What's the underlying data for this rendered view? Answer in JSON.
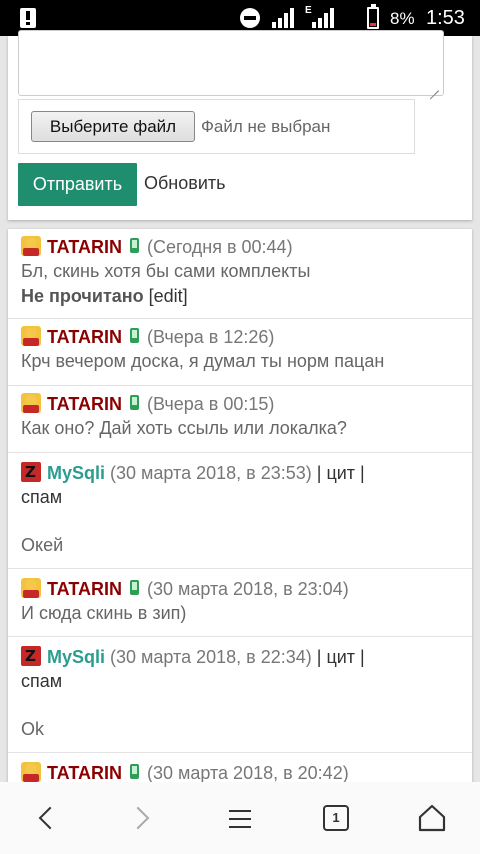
{
  "status_bar": {
    "battery_percent": "8%",
    "time": "1:53",
    "network_type": "E",
    "battery_color": "#e53935"
  },
  "form": {
    "file_button_label": "Выберите файл",
    "file_status": "Файл не выбран",
    "send_button_label": "Отправить",
    "refresh_label": "Обновить",
    "accent_color": "#1e8e6e"
  },
  "messages": [
    {
      "author": "TATARIN",
      "avatar": "tatarin-avatar-icon",
      "device": "mobile-icon",
      "date": "(Сегодня в 00:44)",
      "text": "Бл, скинь хотя бы сами комплекты",
      "unread": "Не прочитано",
      "edit": "[edit]"
    },
    {
      "author": "TATARIN",
      "avatar": "tatarin-avatar-icon",
      "device": "mobile-icon",
      "date": "(Вчера в 12:26)",
      "text": "Крч вечером доска, я думал ты норм пацан"
    },
    {
      "author": "TATARIN",
      "avatar": "tatarin-avatar-icon",
      "device": "mobile-icon",
      "date": "(Вчера в 00:15)",
      "text": "Как оно? Дай хоть ссыль или локалка?"
    },
    {
      "author": "MySqli",
      "avatar": "mysqli-avatar-icon",
      "date": "(30 марта 2018, в 23:53)",
      "actions": "| цит |",
      "actions2": "спам",
      "text": "Окей"
    },
    {
      "author": "TATARIN",
      "avatar": "tatarin-avatar-icon",
      "device": "mobile-icon",
      "date": "(30 марта 2018, в 23:04)",
      "text": "И сюда скинь в зип)"
    },
    {
      "author": "MySqli",
      "avatar": "mysqli-avatar-icon",
      "date": "(30 марта 2018, в 22:34)",
      "actions": "| цит |",
      "actions2": "спам",
      "text": "Ok"
    },
    {
      "author": "TATARIN",
      "avatar": "tatarin-avatar-icon",
      "device": "mobile-icon",
      "date": "(30 марта 2018, в 20:42)"
    }
  ],
  "nav": {
    "back": "back-chevron-icon",
    "forward": "forward-chevron-icon",
    "menu": "menu-icon",
    "tabs_count": "1",
    "home": "home-icon"
  }
}
